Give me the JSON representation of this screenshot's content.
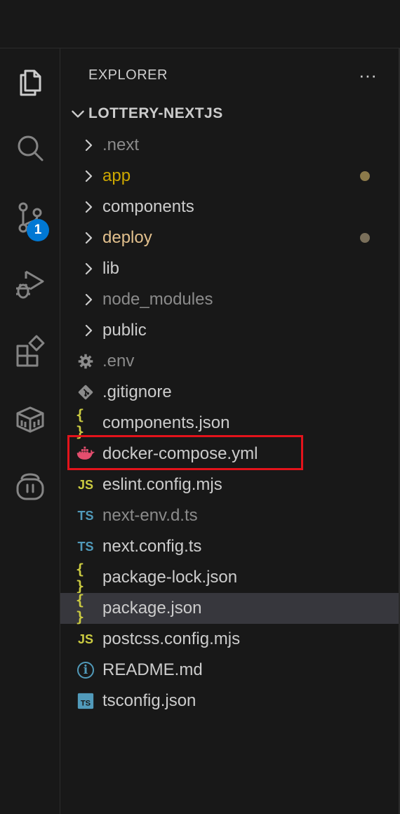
{
  "explorer": {
    "title": "EXPLORER",
    "more_label": "···",
    "project_name": "LOTTERY-NEXTJS"
  },
  "activity_bar": {
    "items": [
      {
        "icon": "files-icon"
      },
      {
        "icon": "search-icon"
      },
      {
        "icon": "source-control-icon",
        "badge": "1"
      },
      {
        "icon": "run-debug-icon"
      },
      {
        "icon": "extensions-icon"
      },
      {
        "icon": "remote-explorer-icon"
      },
      {
        "icon": "copilot-icon"
      }
    ],
    "badge_color": "#0078d4"
  },
  "tree": {
    "items": [
      {
        "name": ".next",
        "type": "folder",
        "color": "#8b8b8b"
      },
      {
        "name": "app",
        "type": "folder",
        "color": "#cca700",
        "dot": "#8c7a4a"
      },
      {
        "name": "components",
        "type": "folder",
        "color": "#cccccc"
      },
      {
        "name": "deploy",
        "type": "folder",
        "color": "#e2c08d",
        "dot": "#7a6f5a"
      },
      {
        "name": "lib",
        "type": "folder",
        "color": "#cccccc"
      },
      {
        "name": "node_modules",
        "type": "folder",
        "color": "#8b8b8b"
      },
      {
        "name": "public",
        "type": "folder",
        "color": "#cccccc"
      },
      {
        "name": ".env",
        "type": "file",
        "icon": "gear-icon",
        "color": "#8b8b8b"
      },
      {
        "name": ".gitignore",
        "type": "file",
        "icon": "git-icon",
        "color": "#cccccc"
      },
      {
        "name": "components.json",
        "type": "file",
        "icon": "json-icon",
        "color": "#cccccc"
      },
      {
        "name": "docker-compose.yml",
        "type": "file",
        "icon": "docker-icon",
        "color": "#cccccc",
        "highlighted": true
      },
      {
        "name": "eslint.config.mjs",
        "type": "file",
        "icon": "js-icon",
        "color": "#cccccc"
      },
      {
        "name": "next-env.d.ts",
        "type": "file",
        "icon": "ts-icon",
        "color": "#8b8b8b"
      },
      {
        "name": "next.config.ts",
        "type": "file",
        "icon": "ts-icon",
        "color": "#cccccc"
      },
      {
        "name": "package-lock.json",
        "type": "file",
        "icon": "json-icon",
        "color": "#cccccc"
      },
      {
        "name": "package.json",
        "type": "file",
        "icon": "json-icon",
        "color": "#cccccc",
        "selected": true
      },
      {
        "name": "postcss.config.mjs",
        "type": "file",
        "icon": "js-icon",
        "color": "#cccccc"
      },
      {
        "name": "README.md",
        "type": "file",
        "icon": "info-icon",
        "color": "#cccccc"
      },
      {
        "name": "tsconfig.json",
        "type": "file",
        "icon": "tsconfig-icon",
        "color": "#cccccc"
      }
    ]
  },
  "icon_glyphs": {
    "json": "{ }",
    "js": "JS",
    "ts": "TS",
    "info": "i"
  },
  "colors": {
    "highlight_box": "#e3131b",
    "selection": "#37373d",
    "json_icon": "#cbcb41",
    "js_icon": "#cbcb41",
    "ts_icon": "#519aba",
    "docker_icon": "#e44e6e"
  }
}
